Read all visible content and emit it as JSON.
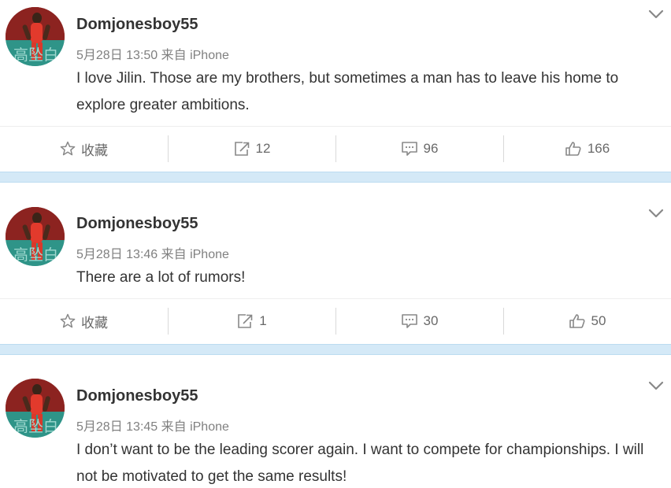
{
  "posts": [
    {
      "username": "Domjonesboy55",
      "meta": "5月28日 13:50 来自 iPhone",
      "content": "I love Jilin. Those are my brothers, but sometimes a man has to leave his home to explore greater ambitions.",
      "actions": {
        "favorite": "收藏",
        "repost": "12",
        "comment": "96",
        "like": "166"
      }
    },
    {
      "username": "Domjonesboy55",
      "meta": "5月28日 13:46 来自 iPhone",
      "content": "There are a lot of rumors!",
      "actions": {
        "favorite": "收藏",
        "repost": "1",
        "comment": "30",
        "like": "50"
      }
    },
    {
      "username": "Domjonesboy55",
      "meta": "5月28日 13:45 来自 iPhone",
      "content": "I don’t want to be the leading scorer again. I want to compete for championships. I will not be motivated to get the same results!"
    }
  ],
  "avatar_text": "高坠白",
  "icons": {
    "favorite": "star-outline-icon",
    "repost": "share-arrow-icon",
    "comment": "comment-bubble-icon",
    "like": "thumbs-up-icon",
    "menu": "chevron-down-icon"
  },
  "colors": {
    "username": "#333333",
    "meta": "#808080",
    "separator": "#d4e9f7",
    "icon": "#888888"
  }
}
